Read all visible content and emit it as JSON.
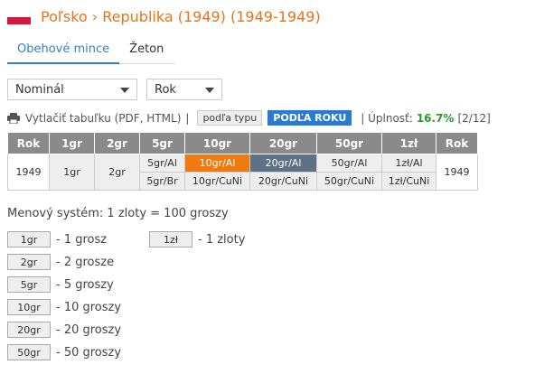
{
  "header": {
    "title": "Poľsko › Republika (1949) (1949-1949)"
  },
  "tabs": [
    {
      "label": "Obehové mince",
      "active": true
    },
    {
      "label": "Žeton",
      "active": false
    }
  ],
  "filters": {
    "denomination": "Nominál",
    "year": "Rok"
  },
  "toolbar": {
    "print_label": "Vytlačiť tabuľku (PDF, HTML)",
    "sep": "|",
    "by_type": "podľa typu",
    "by_year": "PODĽA ROKU",
    "completeness_label": "| Úplnosť:",
    "completeness_pct": "16.7%",
    "completeness_count": "[2/12]"
  },
  "table": {
    "headers": [
      "Rok",
      "1gr",
      "2gr",
      "5gr",
      "10gr",
      "20gr",
      "50gr",
      "1zł",
      "Rok"
    ],
    "year": "1949",
    "row1": {
      "c1gr": "1gr",
      "c2gr": "2gr",
      "c5gr": "5gr/Al",
      "c10gr": "10gr/Al",
      "c20gr": "20gr/Al",
      "c50gr": "50gr/Al",
      "c1zl": "1zł/Al"
    },
    "row2": {
      "c5gr": "5gr/Br",
      "c10gr": "10gr/CuNi",
      "c20gr": "20gr/CuNi",
      "c50gr": "50gr/CuNi",
      "c1zl": "1zł/CuNi"
    }
  },
  "system": {
    "text": "Menový systém: 1 zloty = 100 groszy"
  },
  "legend": [
    {
      "chip": "1gr",
      "desc": "- 1 grosz"
    },
    {
      "chip": "2gr",
      "desc": "- 2 grosze"
    },
    {
      "chip": "5gr",
      "desc": "- 5 groszy"
    },
    {
      "chip": "10gr",
      "desc": "- 10 groszy"
    },
    {
      "chip": "20gr",
      "desc": "- 20 groszy"
    },
    {
      "chip": "50gr",
      "desc": "- 50 groszy"
    },
    {
      "chip": "1zł",
      "desc": "- 1 zloty"
    }
  ],
  "colors": {
    "accent": "#e8731a",
    "link_blue": "#3a7ec0",
    "owned_orange": "#ee7a10",
    "owned_slate": "#5f7186",
    "header_grey": "#8a8a8a"
  }
}
